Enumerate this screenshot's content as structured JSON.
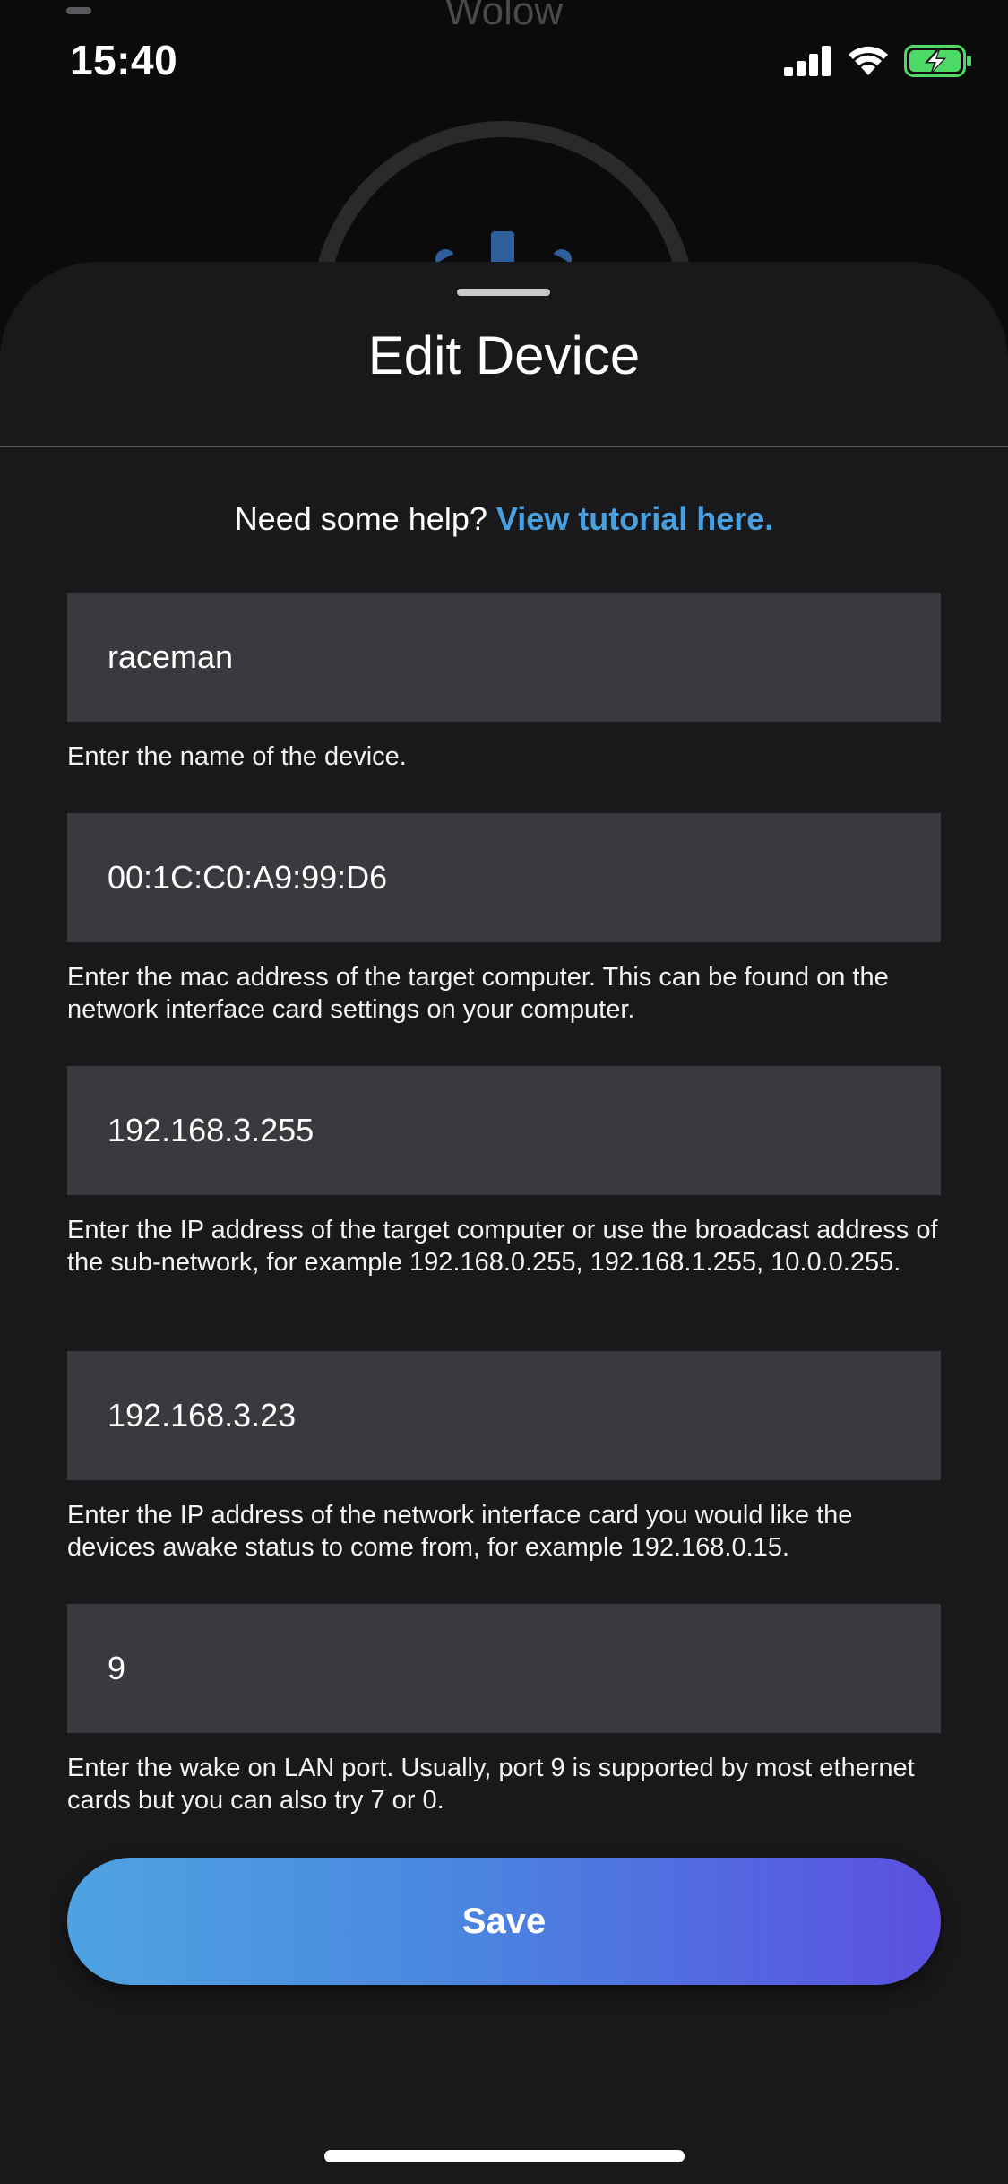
{
  "background_app": {
    "title": "Wolow"
  },
  "status_bar": {
    "time": "15:40",
    "icons": [
      "cellular-signal-icon",
      "wifi-icon",
      "battery-charging-icon"
    ]
  },
  "sheet": {
    "title": "Edit Device",
    "help_prefix": "Need some help? ",
    "help_link": "View tutorial here."
  },
  "form": {
    "name": {
      "value": "raceman",
      "hint": "Enter the name of the device."
    },
    "mac": {
      "value": "00:1C:C0:A9:99:D6",
      "hint": "Enter the mac address of the target computer. This can be found on the network interface card settings on your computer."
    },
    "target_ip": {
      "value": "192.168.3.255",
      "hint": "Enter the IP address of the target computer or use the broadcast address of the sub-network, for example 192.168.0.255, 192.168.1.255, 10.0.0.255."
    },
    "status_ip": {
      "value": "192.168.3.23",
      "hint": "Enter the IP address of the network interface card you would like the devices awake status to come from, for example 192.168.0.15."
    },
    "port": {
      "value": "9",
      "hint": "Enter the wake on LAN port. Usually, port 9 is supported by most ethernet cards but you can also try 7 or 0."
    },
    "save_label": "Save"
  },
  "colors": {
    "sheet_background": "#19191b",
    "field_background": "#3a393d",
    "link": "#4aa0de",
    "button_gradient_start": "#4fa3e1",
    "button_gradient_end": "#5b4fe0",
    "battery": "#4cd964"
  }
}
